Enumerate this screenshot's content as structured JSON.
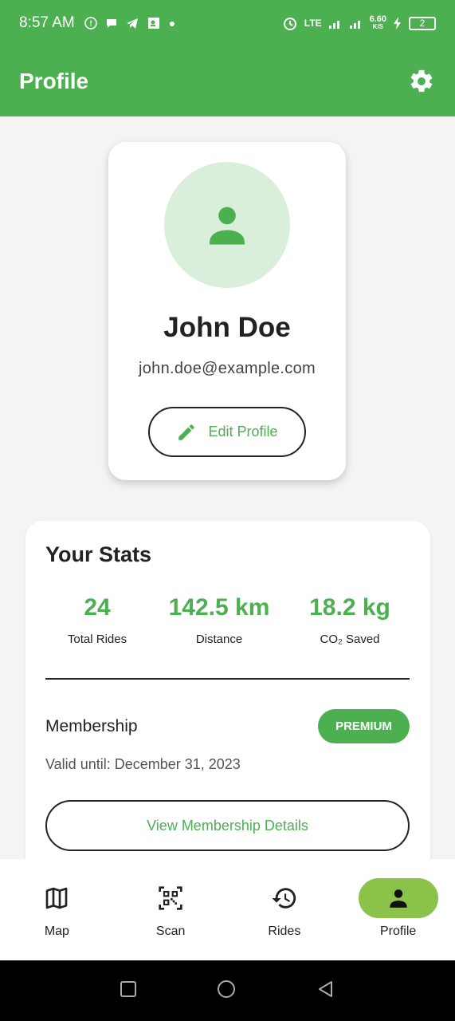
{
  "status_bar": {
    "time": "8:57 AM",
    "network": "LTE",
    "speed_value": "6.60",
    "speed_unit": "K/S",
    "battery": "2"
  },
  "app_bar": {
    "title": "Profile",
    "settings_icon": "gear-icon"
  },
  "profile": {
    "name": "John Doe",
    "email": "john.doe@example.com",
    "edit_label": "Edit Profile"
  },
  "stats": {
    "title": "Your Stats",
    "items": [
      {
        "value": "24",
        "label": "Total Rides"
      },
      {
        "value": "142.5 km",
        "label": "Distance"
      },
      {
        "value": "18.2 kg",
        "label": "CO₂ Saved"
      }
    ],
    "membership_label": "Membership",
    "membership_badge": "PREMIUM",
    "valid_until": "Valid until: December 31, 2023",
    "details_button": "View Membership Details"
  },
  "bottom_nav": {
    "items": [
      {
        "label": "Map",
        "icon": "map-icon"
      },
      {
        "label": "Scan",
        "icon": "qr-scan-icon"
      },
      {
        "label": "Rides",
        "icon": "history-icon"
      },
      {
        "label": "Profile",
        "icon": "person-icon",
        "active": true
      }
    ]
  },
  "colors": {
    "primary": "#4caf50",
    "active_nav": "#8bc34a",
    "avatar_bg": "#d9eedb"
  }
}
